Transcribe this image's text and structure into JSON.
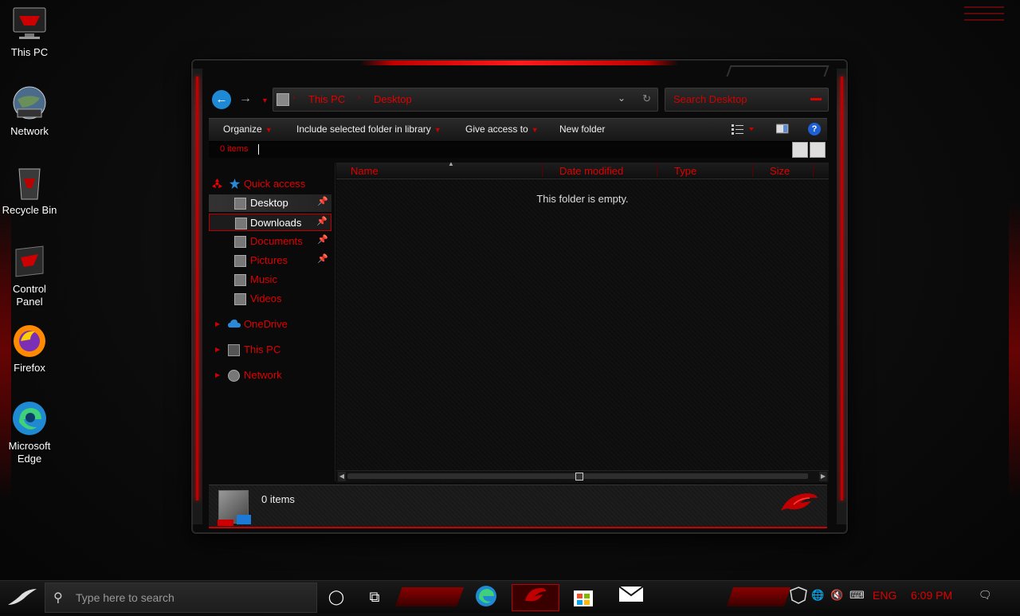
{
  "desktop": {
    "icons": [
      {
        "label": "This PC",
        "icon": "this-pc-icon"
      },
      {
        "label": "Network",
        "icon": "network-globe-icon"
      },
      {
        "label": "Recycle Bin",
        "icon": "recycle-bin-icon"
      },
      {
        "label": "Control Panel",
        "icon": "control-panel-icon"
      },
      {
        "label": "Firefox",
        "icon": "firefox-icon"
      },
      {
        "label": "Microsoft Edge",
        "icon": "edge-icon"
      }
    ]
  },
  "explorer": {
    "address": {
      "crumbs": [
        "This PC",
        "Desktop"
      ],
      "separator": "›"
    },
    "search_placeholder": "Search Desktop",
    "commands": [
      "Organize",
      "Include selected folder in library",
      "Give access to",
      "New folder"
    ],
    "help_label": "?",
    "item_count_top": "0 items",
    "nav": {
      "quick_access": "Quick access",
      "pinned": [
        {
          "label": "Desktop",
          "pinned": true
        },
        {
          "label": "Downloads",
          "pinned": true
        },
        {
          "label": "Documents",
          "pinned": true
        },
        {
          "label": "Pictures",
          "pinned": true
        },
        {
          "label": "Music",
          "pinned": false
        },
        {
          "label": "Videos",
          "pinned": false
        }
      ],
      "roots": [
        "OneDrive",
        "This PC",
        "Network"
      ]
    },
    "columns": [
      "Name",
      "Date modified",
      "Type",
      "Size"
    ],
    "empty_text": "This folder is empty.",
    "details_count": "0 items"
  },
  "taskbar": {
    "search_placeholder": "Type here to search",
    "language": "ENG",
    "time": "6:09 PM",
    "pinned": [
      "cortana-icon",
      "task-view-icon",
      "edge-icon",
      "rog-app-icon",
      "store-icon",
      "mail-icon"
    ]
  },
  "colors": {
    "accent": "#e00000",
    "accent_dark": "#8a0000",
    "link_blue": "#1e8ad6"
  }
}
